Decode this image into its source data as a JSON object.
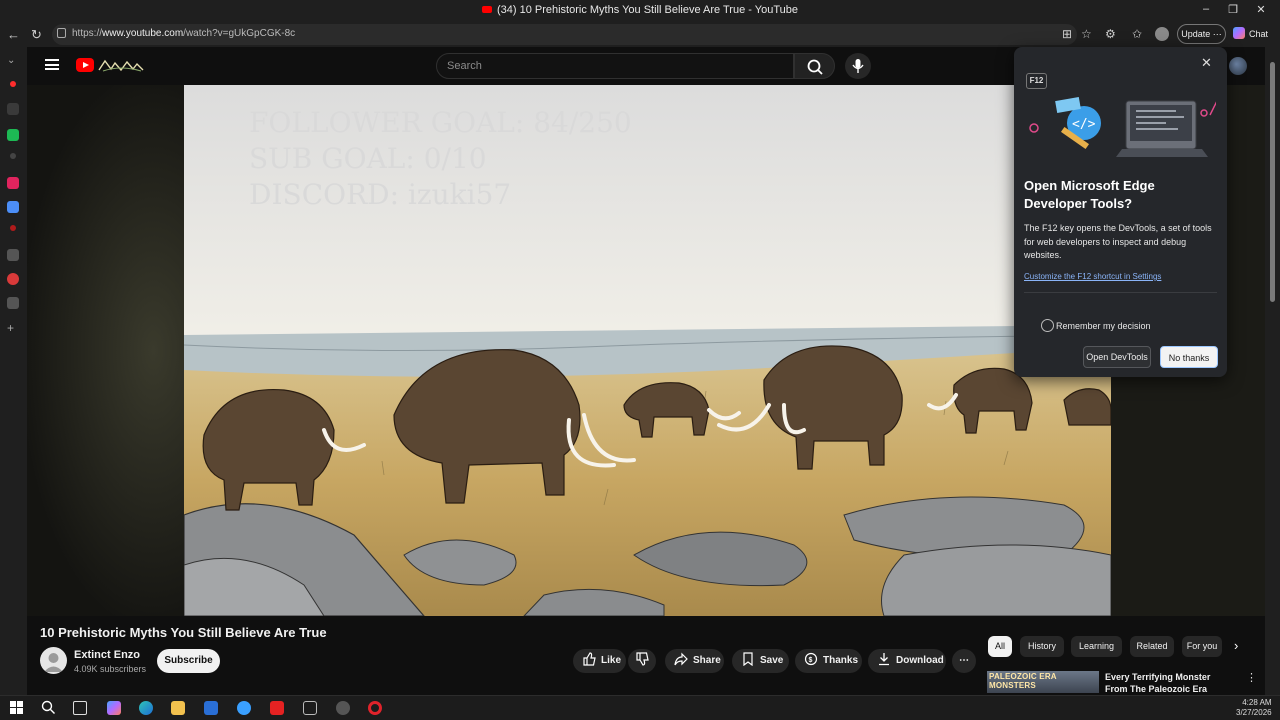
{
  "browser": {
    "window_title": "(34) 10 Prehistoric Myths You Still Believe Are True - YouTube",
    "url_prefix": "https://",
    "url_domain": "www.youtube.com",
    "url_path": "/watch?v=gUkGpCGK-8c",
    "update_label": "Update",
    "chat_label": "Chat"
  },
  "youtube": {
    "search_placeholder": "Search"
  },
  "video": {
    "overlay_lines": [
      "FOLLOWER GOAL:  84/250",
      "SUB GOAL: 0/10",
      "DISCORD: izuki57"
    ],
    "title": "10 Prehistoric Myths You Still Believe Are True",
    "channel_name": "Extinct Enzo",
    "subscribers": "4.09K subscribers",
    "subscribe_label": "Subscribe",
    "actions": {
      "like": "Like",
      "share": "Share",
      "save": "Save",
      "thanks": "Thanks",
      "download": "Download"
    }
  },
  "chips": [
    "All",
    "History",
    "Learning",
    "Related",
    "For you"
  ],
  "recommendation": {
    "thumb_text": "PALEOZOIC ERA MONSTERS",
    "title": "Every Terrifying Monster From The Paleozoic Era"
  },
  "devtools_popup": {
    "key": "F12",
    "heading": "Open Microsoft Edge Developer Tools?",
    "body": "The F12 key opens the DevTools, a set of tools for web developers to inspect and debug websites.",
    "link": "Customize the F12 shortcut in Settings",
    "remember": "Remember my decision",
    "open_button": "Open DevTools",
    "cancel_button": "No thanks"
  },
  "taskbar": {
    "time": "4:28 AM",
    "date": "3/27/2026"
  },
  "colors": {
    "youtube_red": "#ff0000",
    "background": "#0f0f0f",
    "link_blue": "#8ab4f8"
  }
}
